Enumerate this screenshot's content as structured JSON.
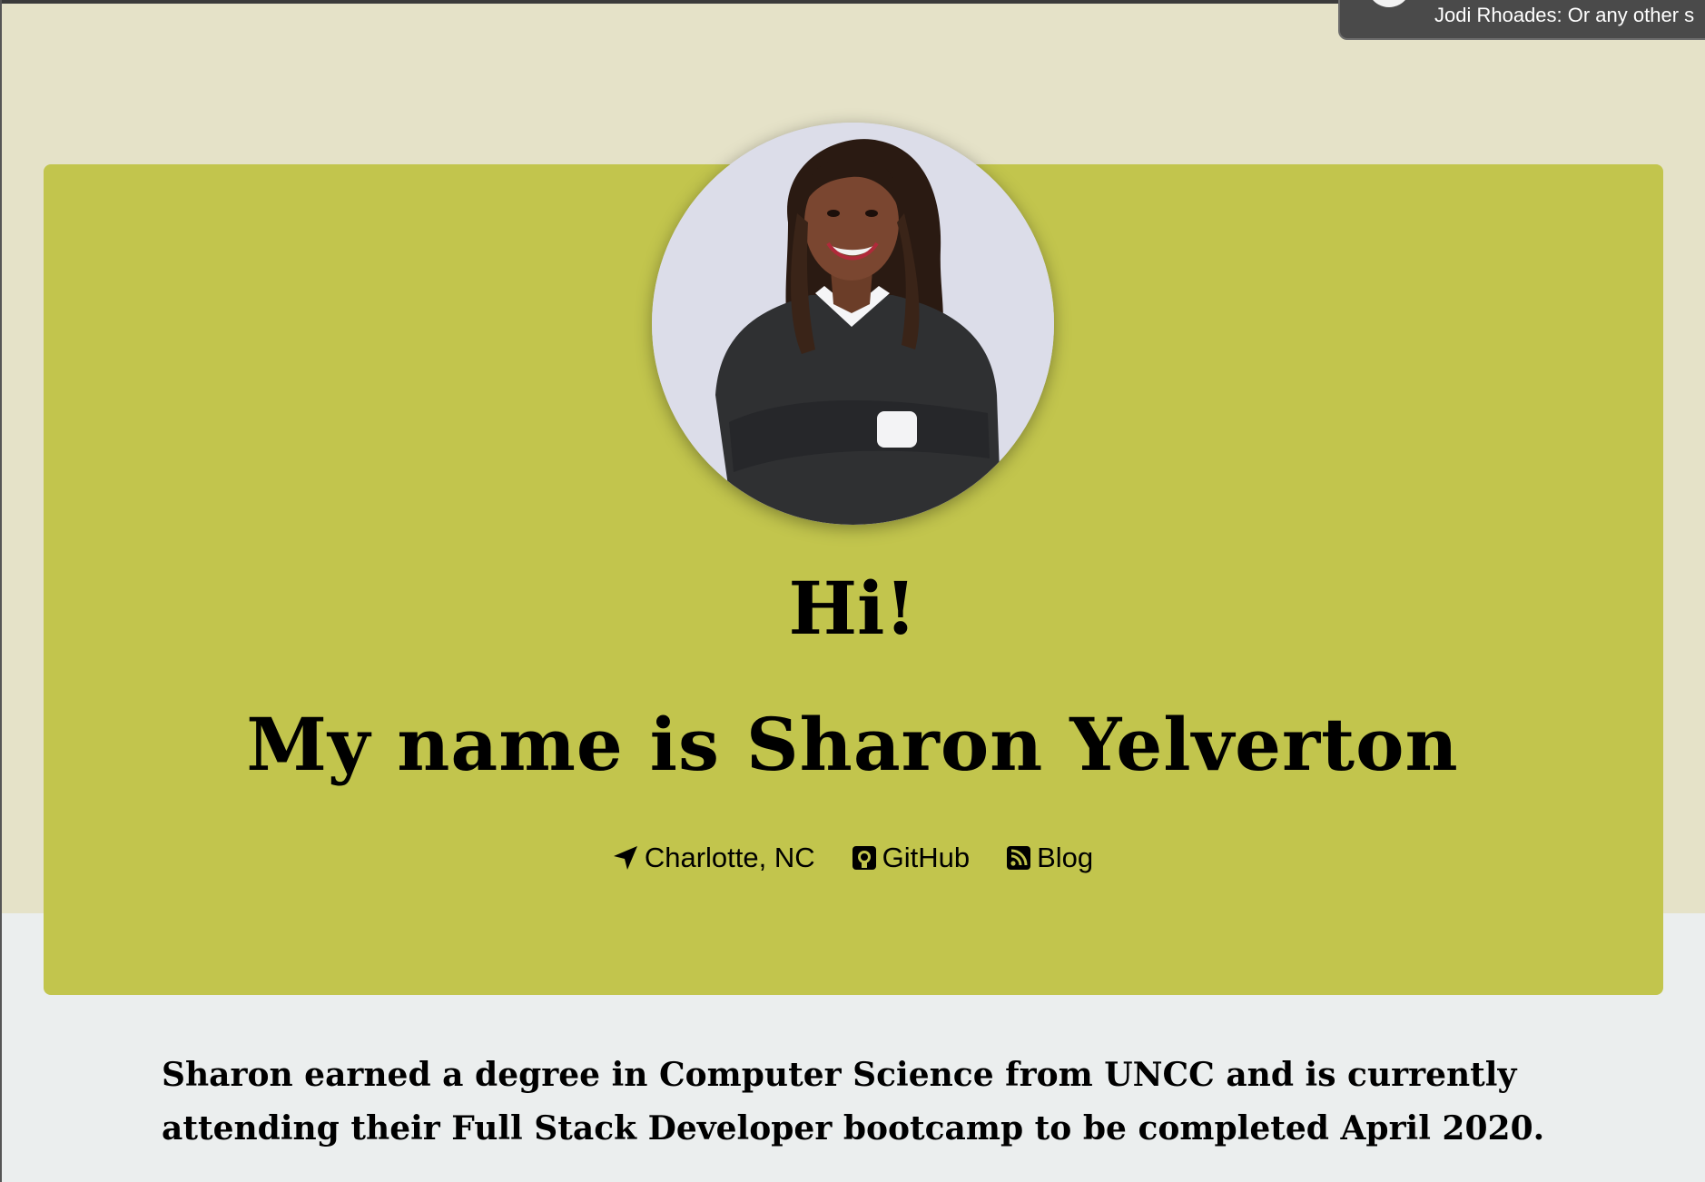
{
  "page": {
    "colors": {
      "hero_background": "#e5e2c8",
      "card": "#c2c54d",
      "page_background": "#ebeeee",
      "text": "#000000"
    }
  },
  "profile": {
    "greeting": "Hi!",
    "name_line": "My name is Sharon Yelverton",
    "photo_icon": "profile-photo"
  },
  "links": [
    {
      "label": "Charlotte, NC",
      "icon": "location-arrow-icon"
    },
    {
      "label": "GitHub",
      "icon": "github-icon"
    },
    {
      "label": "Blog",
      "icon": "rss-icon"
    }
  ],
  "bio": {
    "text": "Sharon earned a degree in Computer Science from UNCC and is currently attending their Full Stack Developer bootcamp to be completed April 2020."
  },
  "notification": {
    "text": "Jodi Rhoades: Or any other s"
  }
}
